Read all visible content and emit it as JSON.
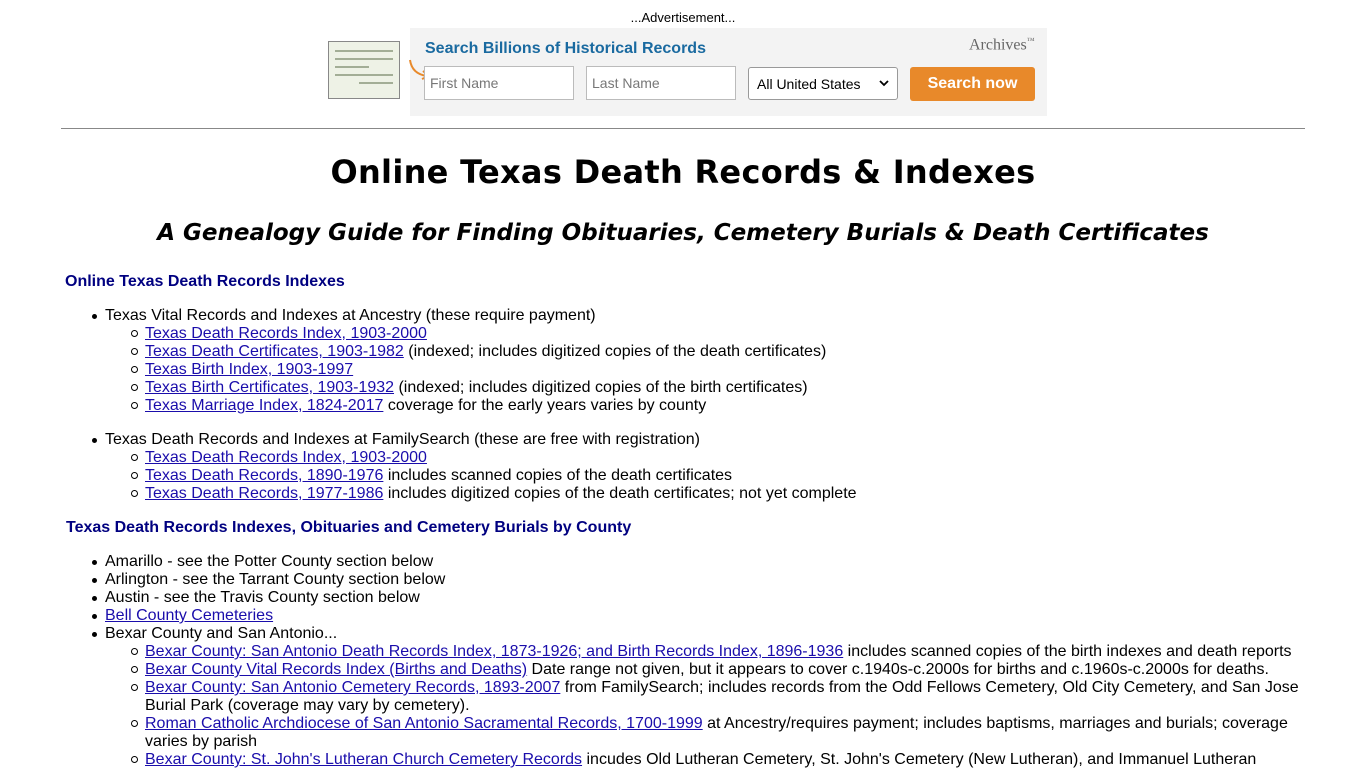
{
  "ad": {
    "label": "...Advertisement...",
    "headline": "Search Billions of Historical Records",
    "brand": "Archives",
    "brand_tm": "™",
    "first_name_placeholder": "First Name",
    "last_name_placeholder": "Last Name",
    "location_selected": "All United States",
    "search_button": "Search now"
  },
  "page": {
    "title": "Online Texas Death Records & Indexes",
    "subtitle": "A Genealogy Guide for Finding Obituaries, Cemetery Burials & Death Certificates"
  },
  "section1": {
    "heading": "Online Texas Death Records Indexes",
    "ancestry": {
      "label": "Texas Vital Records and Indexes at Ancestry (these require payment)",
      "items": [
        {
          "link": "Texas Death Records Index, 1903-2000",
          "note": ""
        },
        {
          "link": "Texas Death Certificates, 1903-1982",
          "note": " (indexed; includes digitized copies of the death certificates)"
        },
        {
          "link": "Texas Birth Index, 1903-1997",
          "note": ""
        },
        {
          "link": "Texas Birth Certificates, 1903-1932",
          "note": " (indexed; includes digitized copies of the birth certificates)"
        },
        {
          "link": "Texas Marriage Index, 1824-2017",
          "note": " coverage for the early years varies by county"
        }
      ]
    },
    "familysearch": {
      "label": "Texas Death Records and Indexes at FamilySearch (these are free with registration)",
      "items": [
        {
          "link": "Texas Death Records Index, 1903-2000",
          "note": ""
        },
        {
          "link": "Texas Death Records, 1890-1976",
          "note": " includes scanned copies of the death certificates"
        },
        {
          "link": "Texas Death Records, 1977-1986",
          "note": " includes digitized copies of the death certificates; not yet complete"
        }
      ]
    }
  },
  "section2": {
    "heading": "Texas Death Records Indexes, Obituaries and Cemetery Burials by County",
    "amarillo": "Amarillo - see the Potter County section below",
    "arlington": "Arlington - see the Tarrant County section below",
    "austin": "Austin - see the Travis County section below",
    "bell": "Bell County Cemeteries",
    "bexar": {
      "label": "Bexar County and San Antonio...",
      "items": [
        {
          "link": "Bexar County: San Antonio Death Records Index, 1873-1926; and Birth Records Index, 1896-1936",
          "note": " includes scanned copies of the birth indexes and death reports"
        },
        {
          "link": "Bexar County Vital Records Index (Births and Deaths)",
          "note": " Date range not given, but it appears to cover c.1940s-c.2000s for births and c.1960s-c.2000s for deaths."
        },
        {
          "link": "Bexar County: San Antonio Cemetery Records, 1893-2007",
          "note": " from FamilySearch; includes records from the Odd Fellows Cemetery, Old City Cemetery, and San Jose Burial Park (coverage may vary by cemetery)."
        },
        {
          "link": "Roman Catholic Archdiocese of San Antonio Sacramental Records, 1700-1999",
          "note": " at Ancestry/requires payment; includes baptisms, marriages and burials; coverage varies by parish"
        },
        {
          "link": "Bexar County: St. John's Lutheran Church Cemetery Records",
          "note": " incudes Old Lutheran Cemetery, St. John's Cemetery (New Lutheran), and Immanuel Lutheran"
        }
      ]
    }
  }
}
